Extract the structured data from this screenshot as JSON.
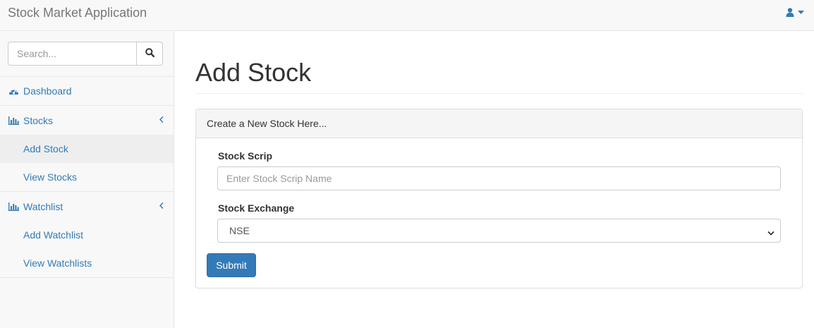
{
  "navbar": {
    "brand": "Stock Market Application",
    "user_icon": "user-icon",
    "caret_icon": "caret-down-icon"
  },
  "sidebar": {
    "search": {
      "placeholder": "Search...",
      "icon": "search-icon"
    },
    "items": [
      {
        "label": "Dashboard",
        "icon": "dashboard-icon"
      },
      {
        "label": "Stocks",
        "icon": "bar-chart-icon",
        "children": [
          "Add Stock",
          "View Stocks"
        ],
        "active_child": "Add Stock"
      },
      {
        "label": "Watchlist",
        "icon": "bar-chart-icon",
        "children": [
          "Add Watchlist",
          "View Watchlists"
        ]
      }
    ]
  },
  "main": {
    "title": "Add Stock",
    "panel": {
      "heading": "Create a New Stock Here...",
      "scrip_label": "Stock Scrip",
      "scrip_placeholder": "Enter Stock Scrip Name",
      "exchange_label": "Stock Exchange",
      "exchange_value": "NSE",
      "submit_label": "Submit"
    }
  },
  "colors": {
    "link": "#337ab7",
    "primary_button": "#337ab7",
    "sidebar_bg": "#f8f8f8",
    "active_item_bg": "#eeeeee"
  }
}
